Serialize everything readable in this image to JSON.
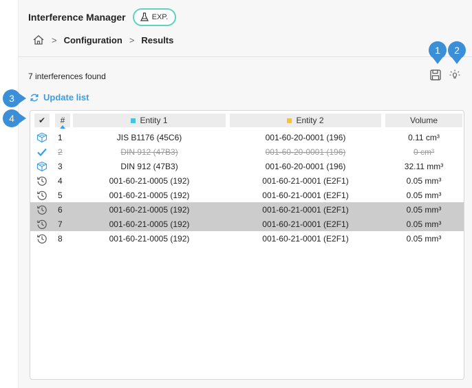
{
  "header": {
    "title": "Interference Manager",
    "badge": "EXP."
  },
  "breadcrumb": {
    "items": [
      "Configuration",
      "Results"
    ],
    "separator": ">"
  },
  "summary": {
    "count_text": "7 interferences found"
  },
  "toolbar": {
    "icons": [
      "save-icon",
      "highlight-bulb-icon"
    ]
  },
  "actions": {
    "update_label": "Update list"
  },
  "table": {
    "columns": {
      "check": "✔",
      "num": "#",
      "entity1": "Entity 1",
      "entity2": "Entity 2",
      "volume": "Volume"
    },
    "entity1_color": "#48c4d8",
    "entity2_color": "#f5c33b",
    "rows": [
      {
        "status": "cube-icon",
        "num": "1",
        "entity1": "JIS B1176 (45C6)",
        "entity2": "001-60-20-0001 (196)",
        "volume": "0.11 cm³"
      },
      {
        "status": "check-icon",
        "num": "2",
        "entity1": "DIN 912 (47B3)",
        "entity2": "001-60-20-0001 (196)",
        "volume": "0 cm³"
      },
      {
        "status": "cube-icon",
        "num": "3",
        "entity1": "DIN 912 (47B3)",
        "entity2": "001-60-20-0001 (196)",
        "volume": "32.11 mm³"
      },
      {
        "status": "history-icon",
        "num": "4",
        "entity1": "001-60-21-0005 (192)",
        "entity2": "001-60-21-0001 (E2F1)",
        "volume": "0.05 mm³"
      },
      {
        "status": "history-icon",
        "num": "5",
        "entity1": "001-60-21-0005 (192)",
        "entity2": "001-60-21-0001 (E2F1)",
        "volume": "0.05 mm³"
      },
      {
        "status": "history-icon",
        "num": "6",
        "entity1": "001-60-21-0005 (192)",
        "entity2": "001-60-21-0001 (E2F1)",
        "volume": "0.05 mm³"
      },
      {
        "status": "history-icon",
        "num": "7",
        "entity1": "001-60-21-0005 (192)",
        "entity2": "001-60-21-0001 (E2F1)",
        "volume": "0.05 mm³"
      },
      {
        "status": "history-icon",
        "num": "8",
        "entity1": "001-60-21-0005 (192)",
        "entity2": "001-60-21-0001 (E2F1)",
        "volume": "0.05 mm³"
      }
    ]
  },
  "callouts": [
    "1",
    "2",
    "3",
    "4"
  ],
  "colors": {
    "accent": "#3a9ee6",
    "callout": "#3a8fd6",
    "badge_border": "#5fd3c0",
    "selected_row": "#cccccc"
  }
}
